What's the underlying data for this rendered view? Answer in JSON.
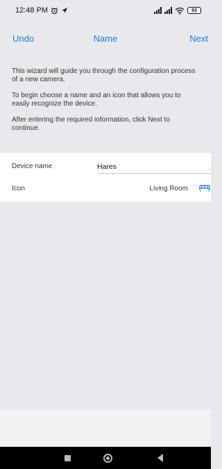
{
  "status_bar": {
    "time": "12:48 PM",
    "alarm_icon": "alarm-clock-icon",
    "location_icon": "navigation-arrow-icon",
    "signal_icons": [
      "signal-bars-icon",
      "signal-bars-icon"
    ],
    "wifi_icon": "wifi-icon",
    "battery_level": "93"
  },
  "nav": {
    "undo_label": "Undo",
    "title": "Name",
    "next_label": "Next"
  },
  "intro": {
    "paragraph1_line1": "This wizard will guide you through the configuration process",
    "paragraph1_line2": "of a new camera.",
    "paragraph2_line1": "To begin choose a name and an icon that allows you to",
    "paragraph2_line2": "easily recognize the device.",
    "paragraph3_line1": "After entering the required information, click Next to",
    "paragraph3_line2": "continue."
  },
  "form": {
    "device_name_label": "Device name",
    "device_name_value": "Hares",
    "icon_label": "Icon",
    "icon_value": "Living Room",
    "icon_glyph": "sofa-icon"
  },
  "colors": {
    "accent": "#1e7ad6",
    "background": "#e9e9ed",
    "form_background": "#ffffff"
  },
  "system_nav": {
    "recent_icon": "square-recent-apps-icon",
    "home_icon": "circle-home-icon",
    "back_icon": "triangle-back-icon"
  }
}
